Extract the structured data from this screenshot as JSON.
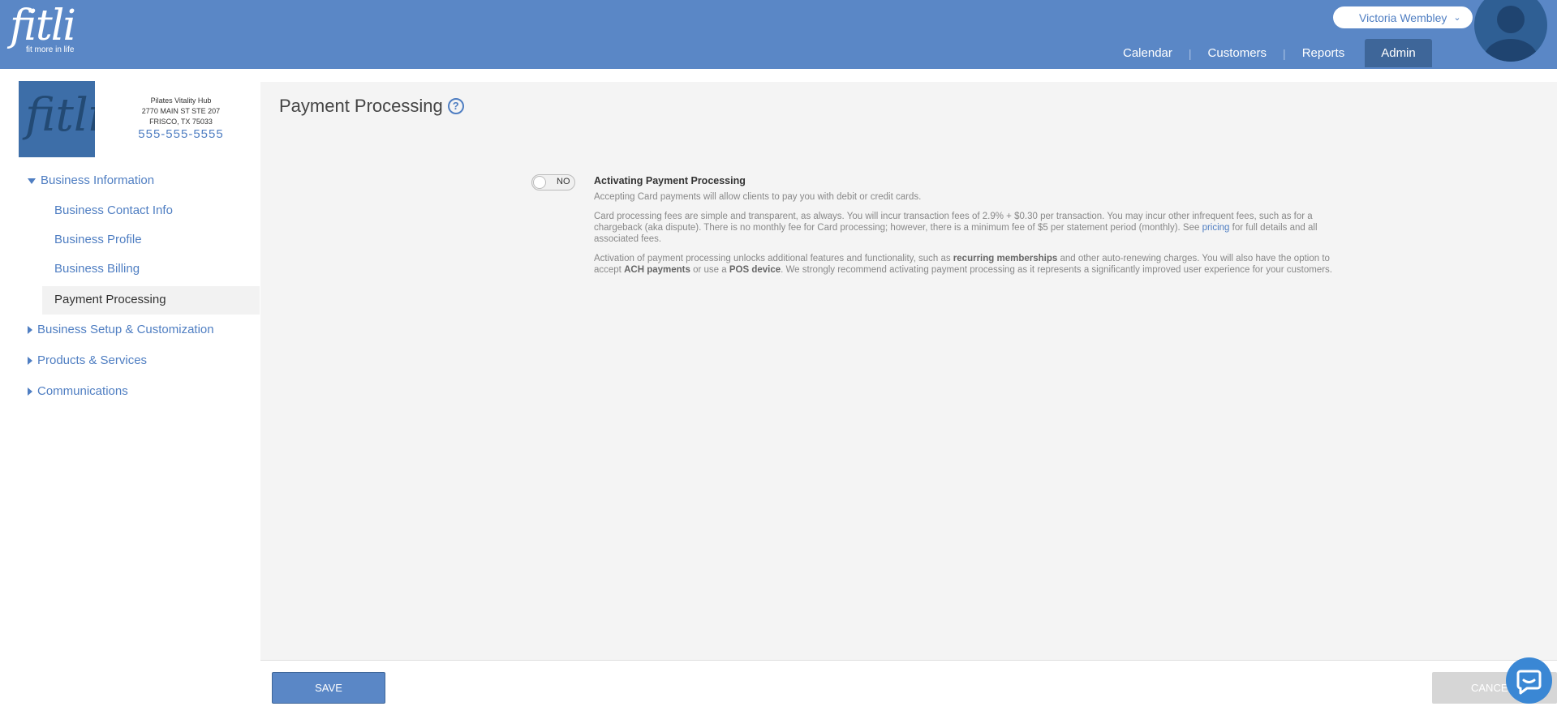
{
  "brand": {
    "wordmark": "fitli",
    "tagline": "fit more in life"
  },
  "user": {
    "name": "Victoria Wembley"
  },
  "nav": {
    "items": [
      {
        "label": "Calendar"
      },
      {
        "label": "Customers"
      },
      {
        "label": "Reports"
      },
      {
        "label": "Admin"
      }
    ],
    "active": "Admin"
  },
  "business": {
    "logo_text": "fitli",
    "name": "Pilates Vitality Hub",
    "address1": "2770 MAIN ST STE 207",
    "address2": "FRISCO, TX 75033",
    "phone": "555-555-5555"
  },
  "sidebar": {
    "business_information": "Business Information",
    "items": [
      {
        "label": "Business Contact Info"
      },
      {
        "label": "Business Profile"
      },
      {
        "label": "Business Billing"
      },
      {
        "label": "Payment Processing"
      }
    ],
    "sections": [
      {
        "label": "Business Setup & Customization"
      },
      {
        "label": "Products & Services"
      },
      {
        "label": "Communications"
      }
    ]
  },
  "page": {
    "title": "Payment Processing",
    "help_glyph": "?"
  },
  "toggle": {
    "label": "NO"
  },
  "description": {
    "heading": "Activating Payment Processing",
    "p1": "Accepting Card payments will allow clients to pay you with debit or credit cards.",
    "p2_a": "Card processing fees are simple and transparent, as always. You will incur transaction fees of 2.9% + $0.30 per transaction. You may incur other infrequent fees, such as for a chargeback (aka dispute). There is no monthly fee for Card processing; however, there is a minimum fee of $5 per statement period (monthly). See ",
    "p2_link": "pricing",
    "p2_b": " for full details and all associated fees.",
    "p3_a": "Activation of payment processing unlocks additional features and functionality, such as ",
    "p3_b1": "recurring memberships",
    "p3_c": " and other auto-renewing charges. You will also have the option to accept ",
    "p3_b2": "ACH payments",
    "p3_d": " or use a ",
    "p3_b3": "POS device",
    "p3_e": ". We strongly recommend activating payment processing as it represents a significantly improved user experience for your customers."
  },
  "footer": {
    "save_label": "SAVE",
    "cancel_label": "CANCEL"
  }
}
